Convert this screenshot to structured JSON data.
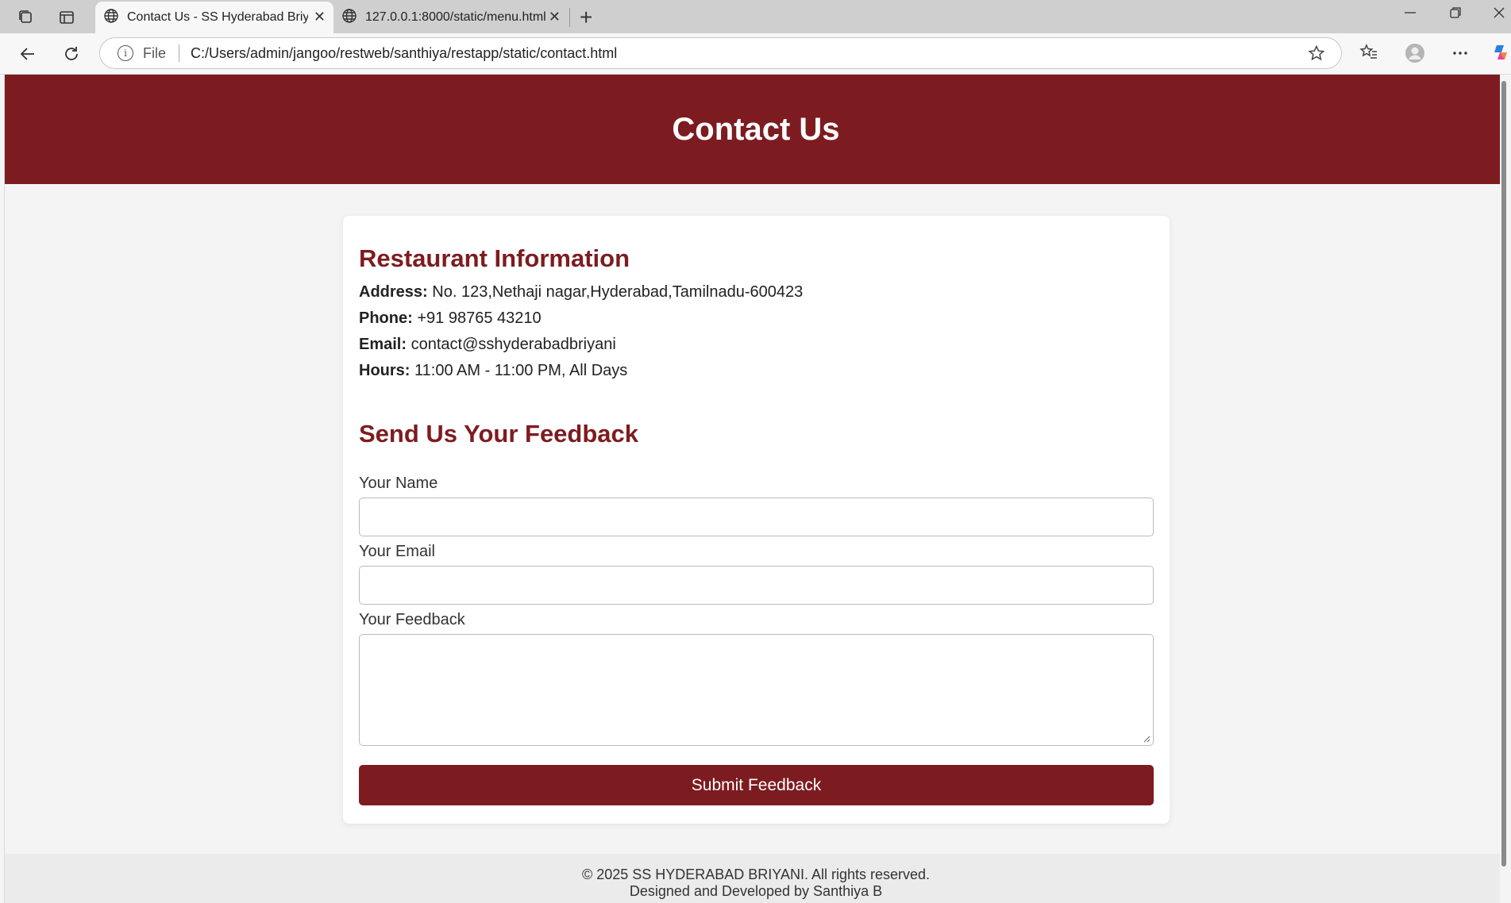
{
  "browser": {
    "tabs": [
      {
        "title": "Contact Us - SS Hyderabad Briyani",
        "active": true
      },
      {
        "title": "127.0.0.1:8000/static/menu.html",
        "active": false
      }
    ],
    "address": {
      "scheme_label": "File",
      "url": "C:/Users/admin/jangoo/restweb/santhiya/restapp/static/contact.html"
    }
  },
  "header": {
    "title": "Contact Us"
  },
  "info": {
    "heading": "Restaurant Information",
    "address_label": "Address:",
    "address_value": "No. 123,Nethaji nagar,Hyderabad,Tamilnadu-600423",
    "phone_label": "Phone:",
    "phone_value": "+91 98765 43210",
    "email_label": "Email:",
    "email_value": "contact@sshyderabadbriyani",
    "hours_label": "Hours:",
    "hours_value": "11:00 AM - 11:00 PM, All Days"
  },
  "feedback": {
    "heading": "Send Us Your Feedback",
    "name_label": "Your Name",
    "name_value": "",
    "email_label": "Your Email",
    "email_value": "",
    "feedback_label": "Your Feedback",
    "feedback_value": "",
    "submit_label": "Submit Feedback"
  },
  "footer": {
    "copyright": "© 2025 SS HYDERABAD BRIYANI. All rights reserved.",
    "credit": "Designed and Developed by Santhiya B"
  },
  "colors": {
    "brand": "#7d1c20",
    "page_bg": "#f4f4f4",
    "card_bg": "#ffffff"
  },
  "icons": [
    "workspaces-icon",
    "tab-actions-icon",
    "globe-icon",
    "close-icon",
    "new-tab-icon",
    "minimize-icon",
    "restore-icon",
    "back-icon",
    "refresh-icon",
    "info-icon",
    "star-icon",
    "favorites-icon",
    "profile-icon",
    "more-icon",
    "copilot-icon"
  ]
}
